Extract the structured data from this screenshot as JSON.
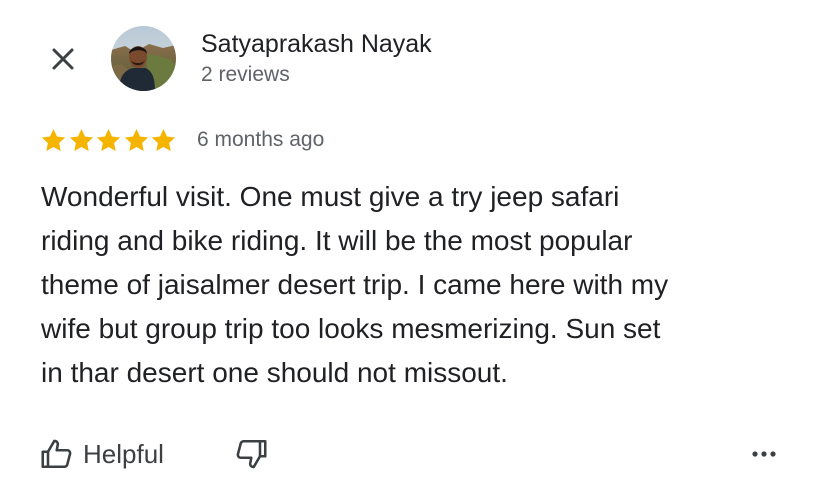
{
  "reviewer": {
    "name": "Satyaprakash Nayak",
    "review_count": "2 reviews"
  },
  "review": {
    "rating": 5,
    "max_rating": 5,
    "date": "6 months ago",
    "text": "Wonderful visit. One must give a try jeep safari\nriding and bike riding. It will be the most popular\ntheme of jaisalmer desert trip. I came here with my\nwife but group trip too looks mesmerizing. Sun set\nin thar desert one should not missout."
  },
  "actions": {
    "helpful_label": "Helpful"
  },
  "icons": {
    "close": "close-icon",
    "star": "star-icon",
    "thumbs_up": "thumbs-up-icon",
    "thumbs_down": "thumbs-down-icon",
    "more": "more-horizontal-icon"
  },
  "colors": {
    "star": "#f4b400",
    "primary_text": "#202124",
    "secondary_text": "#5f6368",
    "icon": "#3c4043"
  }
}
